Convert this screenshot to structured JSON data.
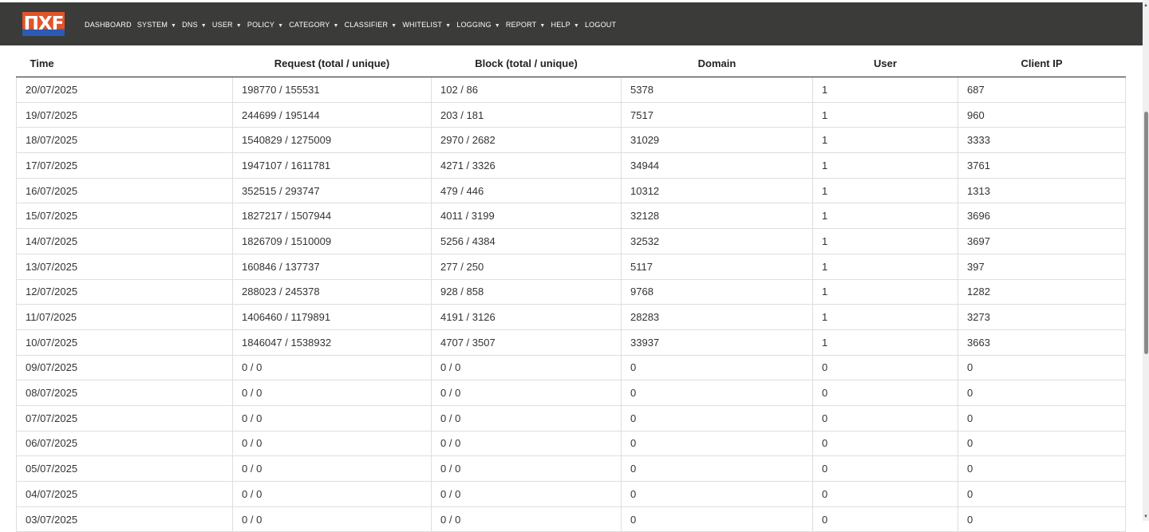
{
  "brand": {
    "logo_text": "ПXF"
  },
  "nav": [
    {
      "label": "DASHBOARD",
      "dropdown": false
    },
    {
      "label": "SYSTEM",
      "dropdown": true
    },
    {
      "label": "DNS",
      "dropdown": true
    },
    {
      "label": "USER",
      "dropdown": true
    },
    {
      "label": "POLICY",
      "dropdown": true
    },
    {
      "label": "CATEGORY",
      "dropdown": true
    },
    {
      "label": "CLASSIFIER",
      "dropdown": true
    },
    {
      "label": "WHITELIST",
      "dropdown": true
    },
    {
      "label": "LOGGING",
      "dropdown": true
    },
    {
      "label": "REPORT",
      "dropdown": true
    },
    {
      "label": "HELP",
      "dropdown": true
    },
    {
      "label": "LOGOUT",
      "dropdown": false
    }
  ],
  "table": {
    "columns": [
      "Time",
      "Request (total / unique)",
      "Block (total / unique)",
      "Domain",
      "User",
      "Client IP"
    ],
    "rows": [
      [
        "20/07/2025",
        "198770 / 155531",
        "102 / 86",
        "5378",
        "1",
        "687"
      ],
      [
        "19/07/2025",
        "244699 / 195144",
        "203 / 181",
        "7517",
        "1",
        "960"
      ],
      [
        "18/07/2025",
        "1540829 / 1275009",
        "2970 / 2682",
        "31029",
        "1",
        "3333"
      ],
      [
        "17/07/2025",
        "1947107 / 1611781",
        "4271 / 3326",
        "34944",
        "1",
        "3761"
      ],
      [
        "16/07/2025",
        "352515 / 293747",
        "479 / 446",
        "10312",
        "1",
        "1313"
      ],
      [
        "15/07/2025",
        "1827217 / 1507944",
        "4011 / 3199",
        "32128",
        "1",
        "3696"
      ],
      [
        "14/07/2025",
        "1826709 / 1510009",
        "5256 / 4384",
        "32532",
        "1",
        "3697"
      ],
      [
        "13/07/2025",
        "160846 / 137737",
        "277 / 250",
        "5117",
        "1",
        "397"
      ],
      [
        "12/07/2025",
        "288023 / 245378",
        "928 / 858",
        "9768",
        "1",
        "1282"
      ],
      [
        "11/07/2025",
        "1406460 / 1179891",
        "4191 / 3126",
        "28283",
        "1",
        "3273"
      ],
      [
        "10/07/2025",
        "1846047 / 1538932",
        "4707 / 3507",
        "33937",
        "1",
        "3663"
      ],
      [
        "09/07/2025",
        "0 / 0",
        "0 / 0",
        "0",
        "0",
        "0"
      ],
      [
        "08/07/2025",
        "0 / 0",
        "0 / 0",
        "0",
        "0",
        "0"
      ],
      [
        "07/07/2025",
        "0 / 0",
        "0 / 0",
        "0",
        "0",
        "0"
      ],
      [
        "06/07/2025",
        "0 / 0",
        "0 / 0",
        "0",
        "0",
        "0"
      ],
      [
        "05/07/2025",
        "0 / 0",
        "0 / 0",
        "0",
        "0",
        "0"
      ],
      [
        "04/07/2025",
        "0 / 0",
        "0 / 0",
        "0",
        "0",
        "0"
      ],
      [
        "03/07/2025",
        "0 / 0",
        "0 / 0",
        "0",
        "0",
        "0"
      ]
    ]
  },
  "colors": {
    "topbar": "#3b3b39",
    "logo_top": "#e1542a",
    "logo_bottom": "#2c5bb6"
  },
  "icons": {
    "dropdown": "caret-down-icon",
    "scroll_up": "arrow-up-icon",
    "scroll_down": "arrow-down-icon"
  }
}
